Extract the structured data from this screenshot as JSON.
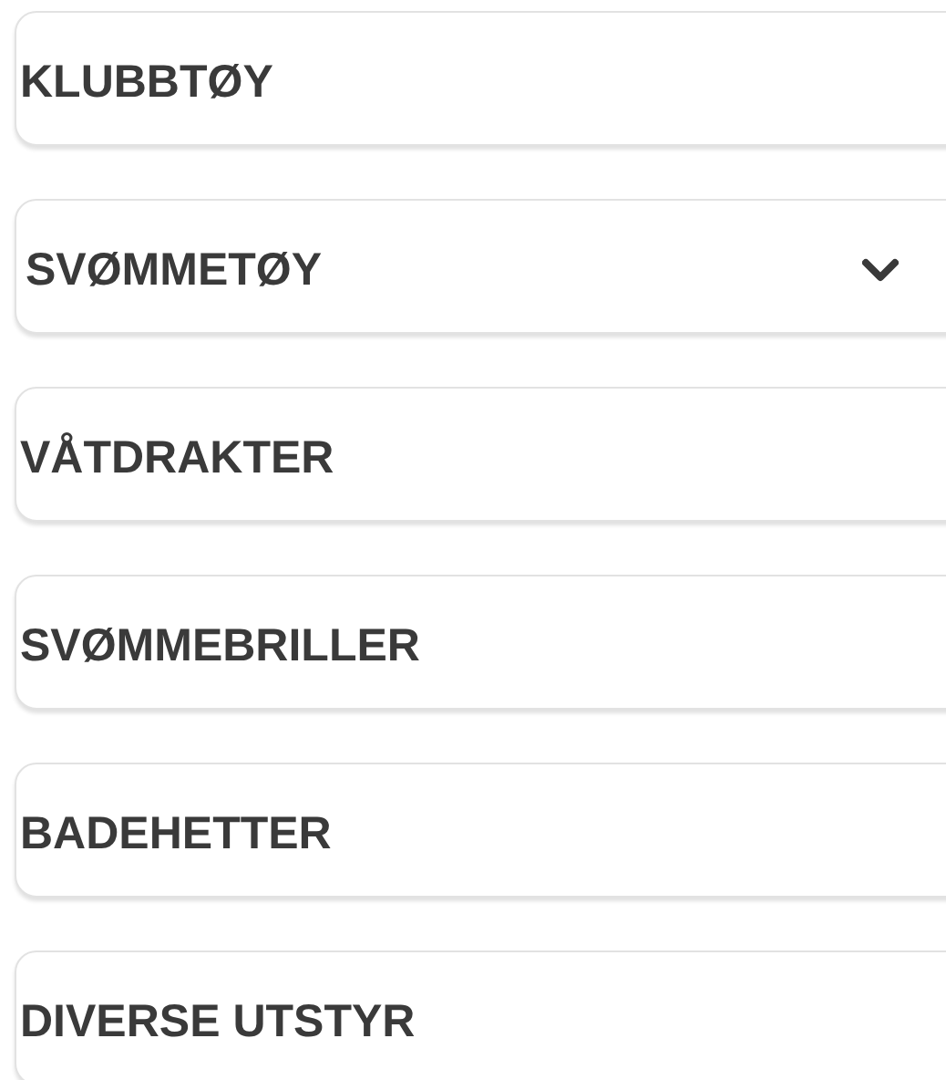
{
  "menu": [
    {
      "label": "KLUBBTØY",
      "kind": "link"
    },
    {
      "label": "SVØMMETØY",
      "kind": "dropdown"
    },
    {
      "label": "VÅTDRAKTER",
      "kind": "link"
    },
    {
      "label": "SVØMMEBRILLER",
      "kind": "link"
    },
    {
      "label": "BADEHETTER",
      "kind": "link"
    },
    {
      "label": "DIVERSE UTSTYR",
      "kind": "link"
    }
  ]
}
